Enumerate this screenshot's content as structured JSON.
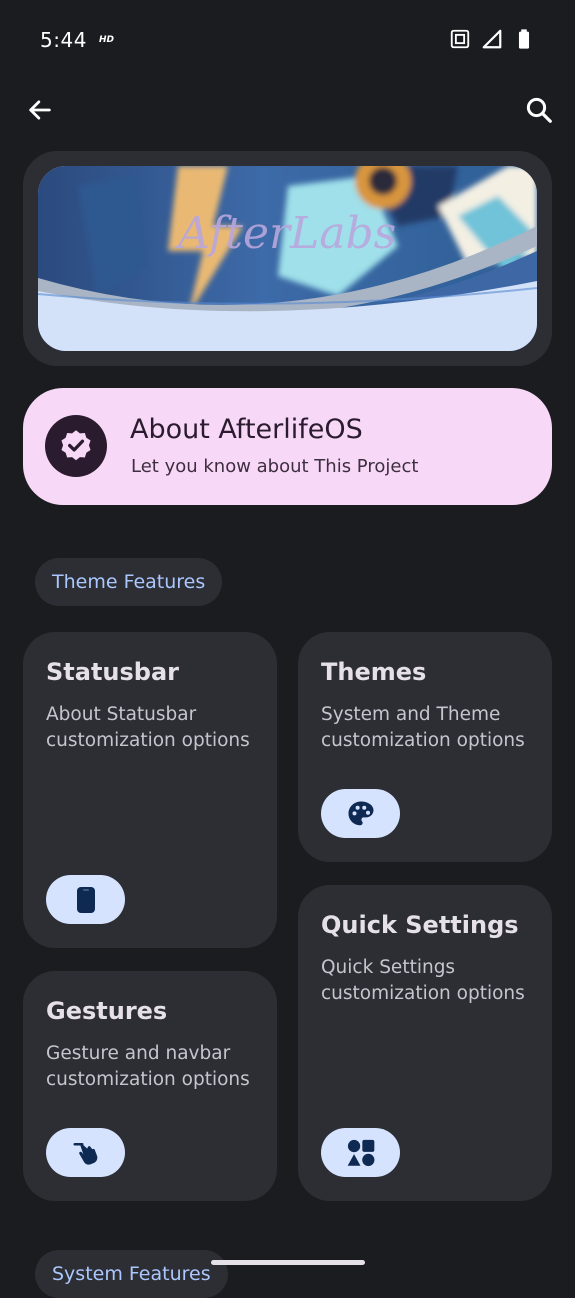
{
  "status_bar": {
    "time": "5:44",
    "network_badge": "HD",
    "icons": [
      "nfc-icon",
      "signal-icon",
      "battery-icon"
    ]
  },
  "app_bar": {
    "back_icon": "arrow-back-icon",
    "search_icon": "search-icon"
  },
  "banner": {
    "text": "AfterLabs"
  },
  "about": {
    "title": "About AfterlifeOS",
    "subtitle": "Let you know about This Project",
    "icon": "verified-badge-icon"
  },
  "sections": [
    {
      "label": "Theme Features",
      "cards": [
        {
          "title": "Statusbar",
          "description": "About Statusbar customization options",
          "icon": "phone-icon"
        },
        {
          "title": "Themes",
          "description": "System and Theme customization options",
          "icon": "palette-icon"
        },
        {
          "title": "Gestures",
          "description": "Gesture and navbar customization options",
          "icon": "gesture-hand-icon"
        },
        {
          "title": "Quick Settings",
          "description": "Quick Settings customization options",
          "icon": "shapes-icon"
        }
      ]
    },
    {
      "label": "System Features"
    }
  ],
  "colors": {
    "background": "#1b1c20",
    "card": "#2d2e33",
    "about_card": "#f8d8f7",
    "accent": "#aac7ff",
    "pill": "#d6e3ff"
  }
}
